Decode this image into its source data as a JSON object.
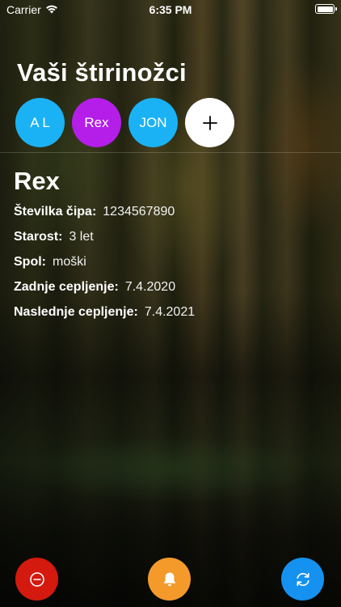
{
  "status_bar": {
    "carrier": "Carrier",
    "time": "6:35 PM",
    "wifi_icon": "wifi-icon",
    "battery_icon": "battery-icon"
  },
  "header": {
    "title": "Vaši štirinožci"
  },
  "pets": [
    {
      "label": "A L",
      "color": "#1ab2f5"
    },
    {
      "label": "Rex",
      "color": "#b51ee8"
    },
    {
      "label": "JON",
      "color": "#1ab2f5"
    }
  ],
  "add_pet": {
    "icon": "plus-icon",
    "color": "#ffffff"
  },
  "selected_pet": {
    "name": "Rex",
    "details": [
      {
        "label": "Številka čipa:",
        "value": "1234567890"
      },
      {
        "label": "Starost:",
        "value": "3 let"
      },
      {
        "label": "Spol:",
        "value": "moški"
      },
      {
        "label": "Zadnje cepljenje:",
        "value": "7.4.2020"
      },
      {
        "label": "Naslednje cepljenje:",
        "value": "7.4.2021"
      }
    ]
  },
  "actions": {
    "remove": {
      "icon": "minus-circle-icon",
      "color": "#d4190f"
    },
    "notify": {
      "icon": "bell-icon",
      "color": "#f49a2a"
    },
    "refresh": {
      "icon": "refresh-icon",
      "color": "#1591f0"
    }
  }
}
